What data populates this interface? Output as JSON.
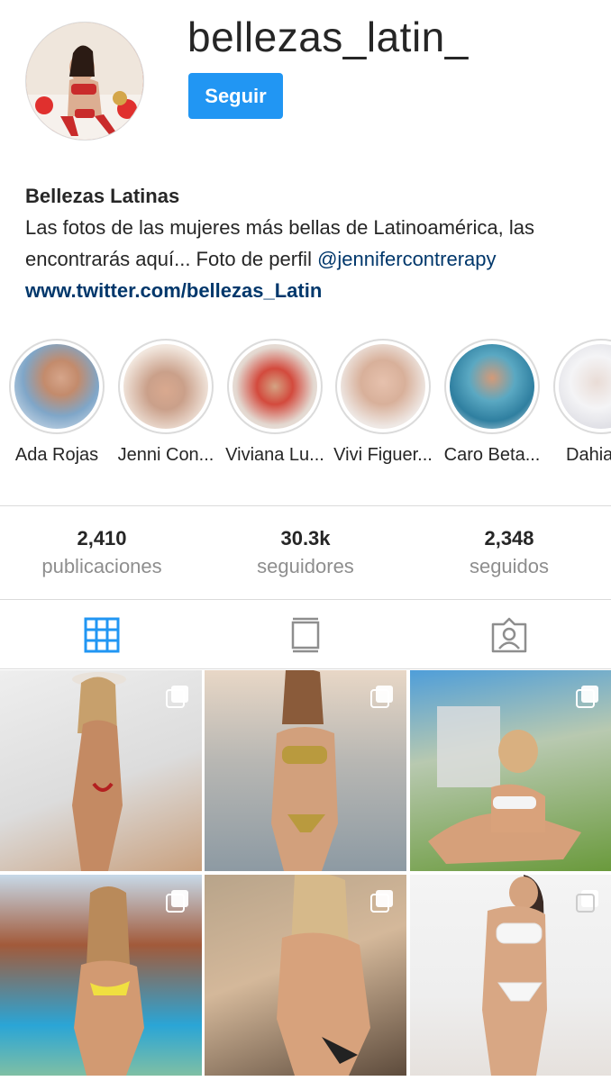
{
  "profile": {
    "username": "bellezas_latin_",
    "follow_label": "Seguir",
    "avatar": "profile-photo"
  },
  "bio": {
    "name": "Bellezas Latinas",
    "text": "Las fotos de las mujeres más bellas de Latinoamérica, las encontrarás aquí... Foto de perfil ",
    "mention": "@jennifercontrerapy",
    "link": "www.twitter.com/bellezas_Latin"
  },
  "highlights": [
    {
      "label": "Ada Rojas",
      "color": "#6b8fb5"
    },
    {
      "label": "Jenni Con...",
      "color": "#e7c9b7"
    },
    {
      "label": "Viviana Lu...",
      "color": "#d85a4c"
    },
    {
      "label": "Vivi Figuer...",
      "color": "#ecdcd2"
    },
    {
      "label": "Caro Beta...",
      "color": "#3f8ea8"
    },
    {
      "label": "Dahia",
      "color": "#e6e6ea"
    }
  ],
  "stats": [
    {
      "value": "2,410",
      "label": "publicaciones"
    },
    {
      "value": "30.3k",
      "label": "seguidores"
    },
    {
      "value": "2,348",
      "label": "seguidos"
    }
  ],
  "tabs": [
    {
      "icon": "grid-icon",
      "active": true
    },
    {
      "icon": "feed-icon",
      "active": false
    },
    {
      "icon": "tagged-icon",
      "active": false
    }
  ],
  "colors": {
    "accent": "#2196f3",
    "link": "#00376b",
    "muted": "#8e8e8e",
    "border": "#dbdbdb"
  },
  "posts": [
    {
      "bg": "linear-gradient(160deg,#eeeeee 0%,#dcdcdc 55%,#c9a17f 100%)"
    },
    {
      "bg": "linear-gradient(180deg,#e8d7c6 0%,#b8b7b3 45%,#8d9aa3 100%)"
    },
    {
      "bg": "linear-gradient(170deg,#4f9ed9 0%,#b8c9b0 40%,#6a9a3c 100%)"
    },
    {
      "bg": "linear-gradient(180deg,#c7d9e8 0%,#a25a3a 35%,#2aa5d6 75%,#7fbfa4 100%)"
    },
    {
      "bg": "linear-gradient(160deg,#b8a48a 0%,#d4b89a 45%,#5d4b3c 100%)"
    },
    {
      "bg": "linear-gradient(180deg,#f4f4f4 0%,#eeeeee 60%,#e6e1dd 100%)"
    }
  ]
}
